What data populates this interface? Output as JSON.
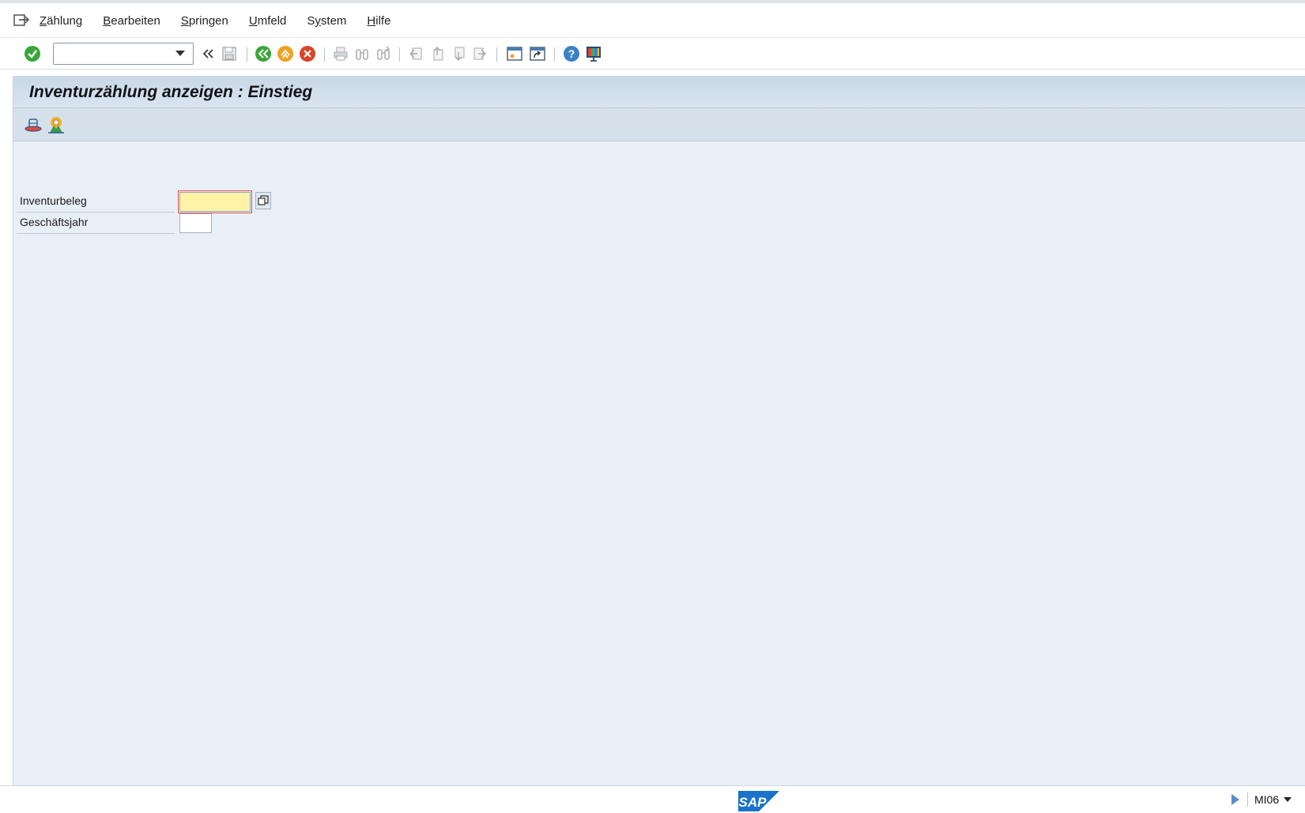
{
  "menu": {
    "items": [
      {
        "accel": "Z",
        "rest": "ählung"
      },
      {
        "accel": "B",
        "rest": "earbeiten"
      },
      {
        "accel": "S",
        "rest": "pringen"
      },
      {
        "accel": "U",
        "rest": "mfeld"
      },
      {
        "accel": "",
        "pre": "S",
        "accel2": "y",
        "rest": "stem"
      },
      {
        "accel": "H",
        "rest": "ilfe"
      }
    ],
    "labels": [
      "Zählung",
      "Bearbeiten",
      "Springen",
      "Umfeld",
      "System",
      "Hilfe"
    ]
  },
  "toolbar": {
    "command_value": "",
    "icons": [
      "enter-icon",
      "back-arrows-icon",
      "save-icon",
      "back-icon",
      "exit-icon",
      "cancel-icon",
      "print-icon",
      "find-icon",
      "find-next-icon",
      "first-page-icon",
      "previous-page-icon",
      "next-page-icon",
      "last-page-icon",
      "create-session-icon",
      "shortcut-icon",
      "help-icon",
      "customize-layout-icon"
    ]
  },
  "screen": {
    "title": "Inventurzählung anzeigen  : Einstieg"
  },
  "form": {
    "inventurbeleg_label": "Inventurbeleg",
    "inventurbeleg_value": "",
    "geschaeftsjahr_label": "Geschäftsjahr",
    "geschaeftsjahr_value": ""
  },
  "status": {
    "logo_text": "SAP",
    "tcode": "MI06"
  },
  "colors": {
    "enter": "#3aa63a",
    "exit": "#f0a020",
    "cancel": "#d8452a",
    "help": "#3b82c4",
    "sap_blue": "#1a73c8"
  }
}
